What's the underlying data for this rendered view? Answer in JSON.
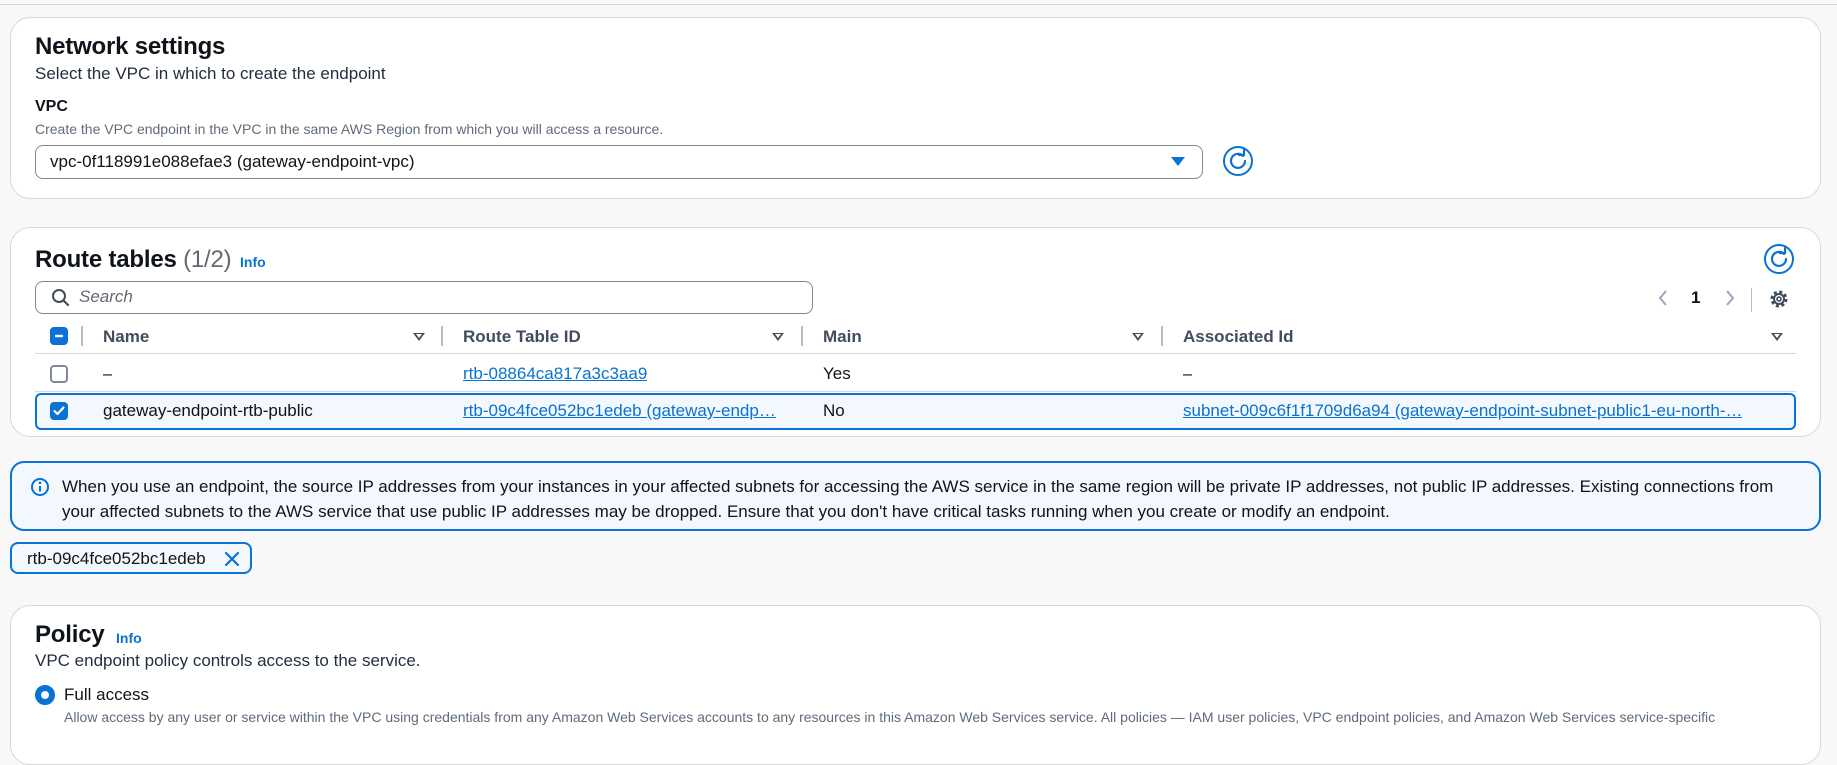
{
  "network": {
    "title": "Network settings",
    "description": "Select the VPC in which to create the endpoint",
    "vpc_label": "VPC",
    "vpc_hint": "Create the VPC endpoint in the VPC in the same AWS Region from which you will access a resource.",
    "vpc_value": "vpc-0f118991e088efae3 (gateway-endpoint-vpc)"
  },
  "route_tables": {
    "title": "Route tables",
    "count": "(1/2)",
    "info": "Info",
    "search_placeholder": "Search",
    "page": "1",
    "columns": [
      "Name",
      "Route Table ID",
      "Main",
      "Associated Id"
    ],
    "rows": [
      {
        "selected": false,
        "name": "–",
        "route_table_id": "rtb-08864ca817a3c3aa9",
        "main": "Yes",
        "associated_id": "–"
      },
      {
        "selected": true,
        "name": "gateway-endpoint-rtb-public",
        "route_table_id": "rtb-09c4fce052bc1edeb (gateway-endp…",
        "main": "No",
        "associated_id": "subnet-009c6f1f1709d6a94 (gateway-endpoint-subnet-public1-eu-north-…"
      }
    ]
  },
  "alert": {
    "text": "When you use an endpoint, the source IP addresses from your instances in your affected subnets for accessing the AWS service in the same region will be private IP addresses, not public IP addresses. Existing connections from your affected subnets to the AWS service that use public IP addresses may be dropped. Ensure that you don't have critical tasks running when you create or modify an endpoint."
  },
  "token": {
    "label": "rtb-09c4fce052bc1edeb"
  },
  "policy": {
    "title": "Policy",
    "info": "Info",
    "description": "VPC endpoint policy controls access to the service.",
    "option_label": "Full access",
    "option_hint": "Allow access by any user or service within the VPC using credentials from any Amazon Web Services accounts to any resources in this Amazon Web Services service. All policies — IAM user policies, VPC endpoint policies, and Amazon Web Services service-specific"
  },
  "colors": {
    "accent": "#0972d3",
    "alert_bg": "#f2f8fd",
    "text": "#0f141a"
  },
  "icons": [
    "caret-down-icon",
    "refresh-icon",
    "search-icon",
    "chevron-left-icon",
    "chevron-right-icon",
    "gear-icon",
    "check-icon",
    "minus-icon",
    "info-circle-icon",
    "close-icon"
  ]
}
